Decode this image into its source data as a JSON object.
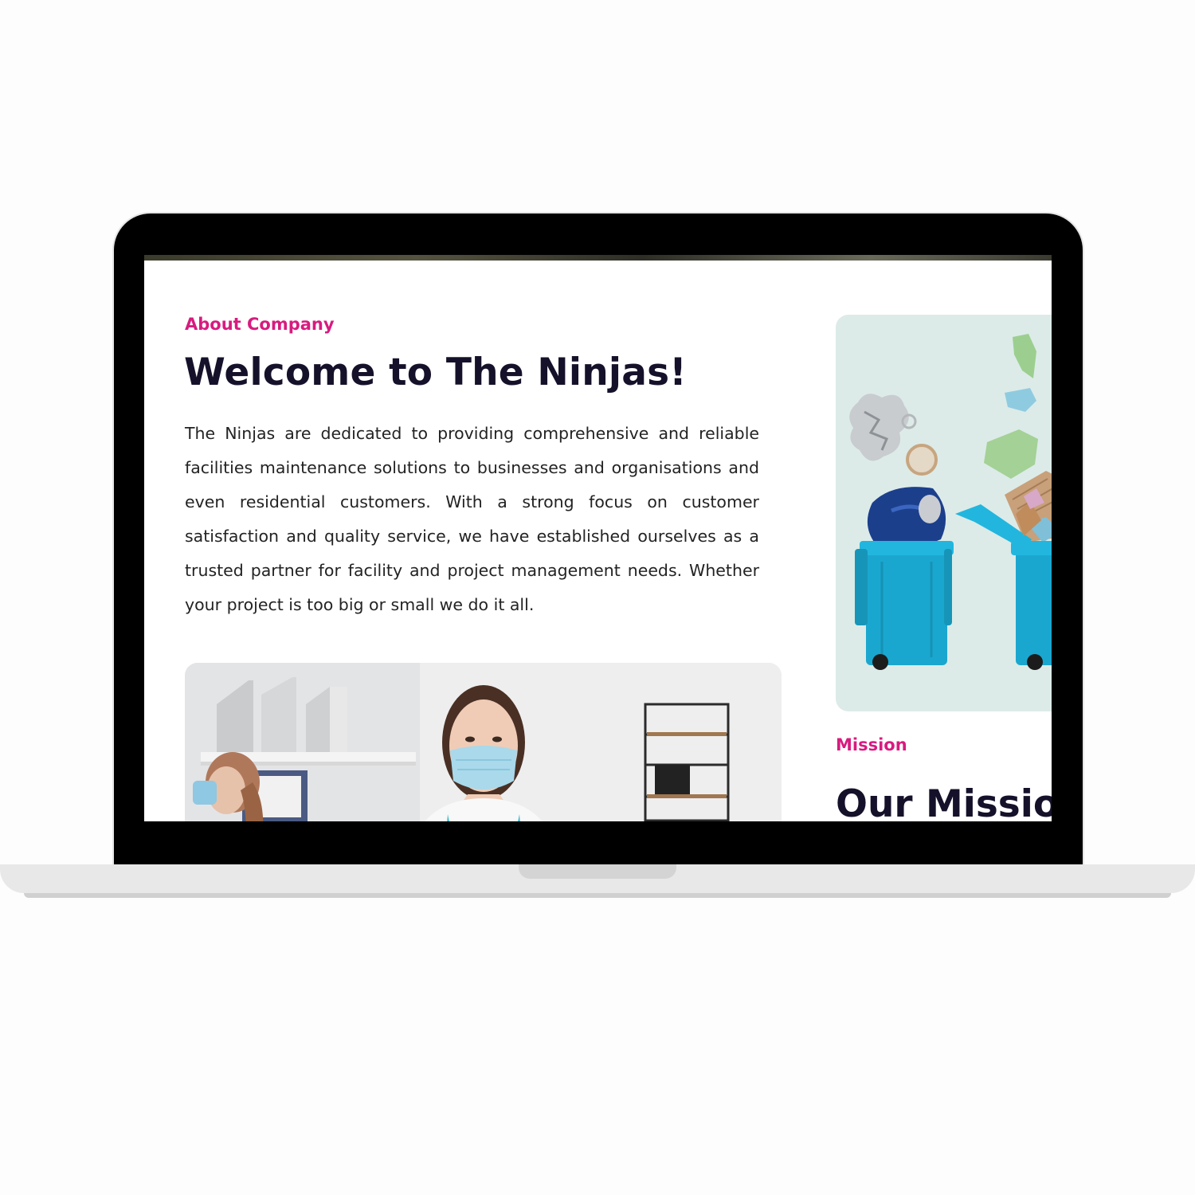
{
  "about": {
    "eyebrow": "About Company",
    "title": "Welcome to The Ninjas!",
    "paragraph": "The Ninjas are dedicated to providing comprehensive and reliable facilities maintenance solutions to businesses and organisations and even residential customers. With a strong focus on customer satisfaction and quality service, we have established ourselves as a trusted partner for facility and project management needs. Whether your project is too big or small we do it all."
  },
  "mission": {
    "eyebrow": "Mission",
    "title": "Our Missio"
  },
  "colors": {
    "accent": "#d81b7f",
    "heading": "#16112a",
    "body_text": "#232323",
    "bin_blue": "#1aa7cf",
    "recycle_bg": "#dcebe8"
  },
  "images": {
    "cleaner_photo": "photo-cleaner-in-mask",
    "recycle_photo": "photo-recycling-bins"
  }
}
